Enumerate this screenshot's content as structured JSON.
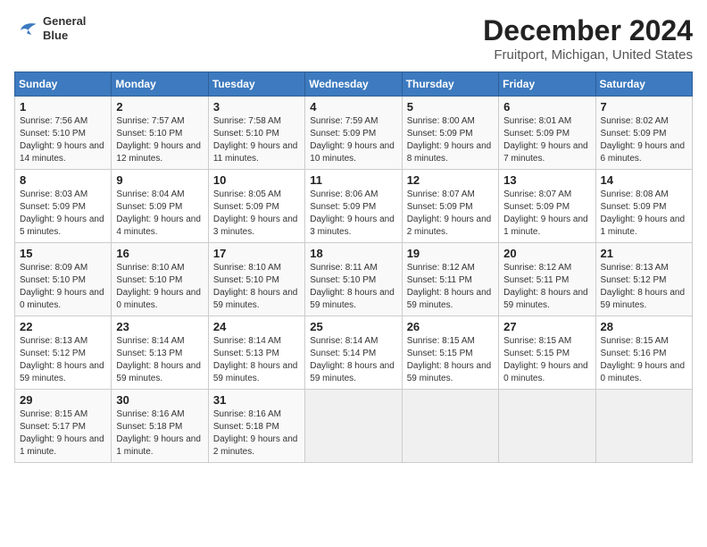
{
  "logo": {
    "line1": "General",
    "line2": "Blue"
  },
  "title": "December 2024",
  "subtitle": "Fruitport, Michigan, United States",
  "days_of_week": [
    "Sunday",
    "Monday",
    "Tuesday",
    "Wednesday",
    "Thursday",
    "Friday",
    "Saturday"
  ],
  "weeks": [
    [
      {
        "day": "1",
        "info": "Sunrise: 7:56 AM\nSunset: 5:10 PM\nDaylight: 9 hours and 14 minutes."
      },
      {
        "day": "2",
        "info": "Sunrise: 7:57 AM\nSunset: 5:10 PM\nDaylight: 9 hours and 12 minutes."
      },
      {
        "day": "3",
        "info": "Sunrise: 7:58 AM\nSunset: 5:10 PM\nDaylight: 9 hours and 11 minutes."
      },
      {
        "day": "4",
        "info": "Sunrise: 7:59 AM\nSunset: 5:09 PM\nDaylight: 9 hours and 10 minutes."
      },
      {
        "day": "5",
        "info": "Sunrise: 8:00 AM\nSunset: 5:09 PM\nDaylight: 9 hours and 8 minutes."
      },
      {
        "day": "6",
        "info": "Sunrise: 8:01 AM\nSunset: 5:09 PM\nDaylight: 9 hours and 7 minutes."
      },
      {
        "day": "7",
        "info": "Sunrise: 8:02 AM\nSunset: 5:09 PM\nDaylight: 9 hours and 6 minutes."
      }
    ],
    [
      {
        "day": "8",
        "info": "Sunrise: 8:03 AM\nSunset: 5:09 PM\nDaylight: 9 hours and 5 minutes."
      },
      {
        "day": "9",
        "info": "Sunrise: 8:04 AM\nSunset: 5:09 PM\nDaylight: 9 hours and 4 minutes."
      },
      {
        "day": "10",
        "info": "Sunrise: 8:05 AM\nSunset: 5:09 PM\nDaylight: 9 hours and 3 minutes."
      },
      {
        "day": "11",
        "info": "Sunrise: 8:06 AM\nSunset: 5:09 PM\nDaylight: 9 hours and 3 minutes."
      },
      {
        "day": "12",
        "info": "Sunrise: 8:07 AM\nSunset: 5:09 PM\nDaylight: 9 hours and 2 minutes."
      },
      {
        "day": "13",
        "info": "Sunrise: 8:07 AM\nSunset: 5:09 PM\nDaylight: 9 hours and 1 minute."
      },
      {
        "day": "14",
        "info": "Sunrise: 8:08 AM\nSunset: 5:09 PM\nDaylight: 9 hours and 1 minute."
      }
    ],
    [
      {
        "day": "15",
        "info": "Sunrise: 8:09 AM\nSunset: 5:10 PM\nDaylight: 9 hours and 0 minutes."
      },
      {
        "day": "16",
        "info": "Sunrise: 8:10 AM\nSunset: 5:10 PM\nDaylight: 9 hours and 0 minutes."
      },
      {
        "day": "17",
        "info": "Sunrise: 8:10 AM\nSunset: 5:10 PM\nDaylight: 8 hours and 59 minutes."
      },
      {
        "day": "18",
        "info": "Sunrise: 8:11 AM\nSunset: 5:10 PM\nDaylight: 8 hours and 59 minutes."
      },
      {
        "day": "19",
        "info": "Sunrise: 8:12 AM\nSunset: 5:11 PM\nDaylight: 8 hours and 59 minutes."
      },
      {
        "day": "20",
        "info": "Sunrise: 8:12 AM\nSunset: 5:11 PM\nDaylight: 8 hours and 59 minutes."
      },
      {
        "day": "21",
        "info": "Sunrise: 8:13 AM\nSunset: 5:12 PM\nDaylight: 8 hours and 59 minutes."
      }
    ],
    [
      {
        "day": "22",
        "info": "Sunrise: 8:13 AM\nSunset: 5:12 PM\nDaylight: 8 hours and 59 minutes."
      },
      {
        "day": "23",
        "info": "Sunrise: 8:14 AM\nSunset: 5:13 PM\nDaylight: 8 hours and 59 minutes."
      },
      {
        "day": "24",
        "info": "Sunrise: 8:14 AM\nSunset: 5:13 PM\nDaylight: 8 hours and 59 minutes."
      },
      {
        "day": "25",
        "info": "Sunrise: 8:14 AM\nSunset: 5:14 PM\nDaylight: 8 hours and 59 minutes."
      },
      {
        "day": "26",
        "info": "Sunrise: 8:15 AM\nSunset: 5:15 PM\nDaylight: 8 hours and 59 minutes."
      },
      {
        "day": "27",
        "info": "Sunrise: 8:15 AM\nSunset: 5:15 PM\nDaylight: 9 hours and 0 minutes."
      },
      {
        "day": "28",
        "info": "Sunrise: 8:15 AM\nSunset: 5:16 PM\nDaylight: 9 hours and 0 minutes."
      }
    ],
    [
      {
        "day": "29",
        "info": "Sunrise: 8:15 AM\nSunset: 5:17 PM\nDaylight: 9 hours and 1 minute."
      },
      {
        "day": "30",
        "info": "Sunrise: 8:16 AM\nSunset: 5:18 PM\nDaylight: 9 hours and 1 minute."
      },
      {
        "day": "31",
        "info": "Sunrise: 8:16 AM\nSunset: 5:18 PM\nDaylight: 9 hours and 2 minutes."
      },
      null,
      null,
      null,
      null
    ]
  ]
}
